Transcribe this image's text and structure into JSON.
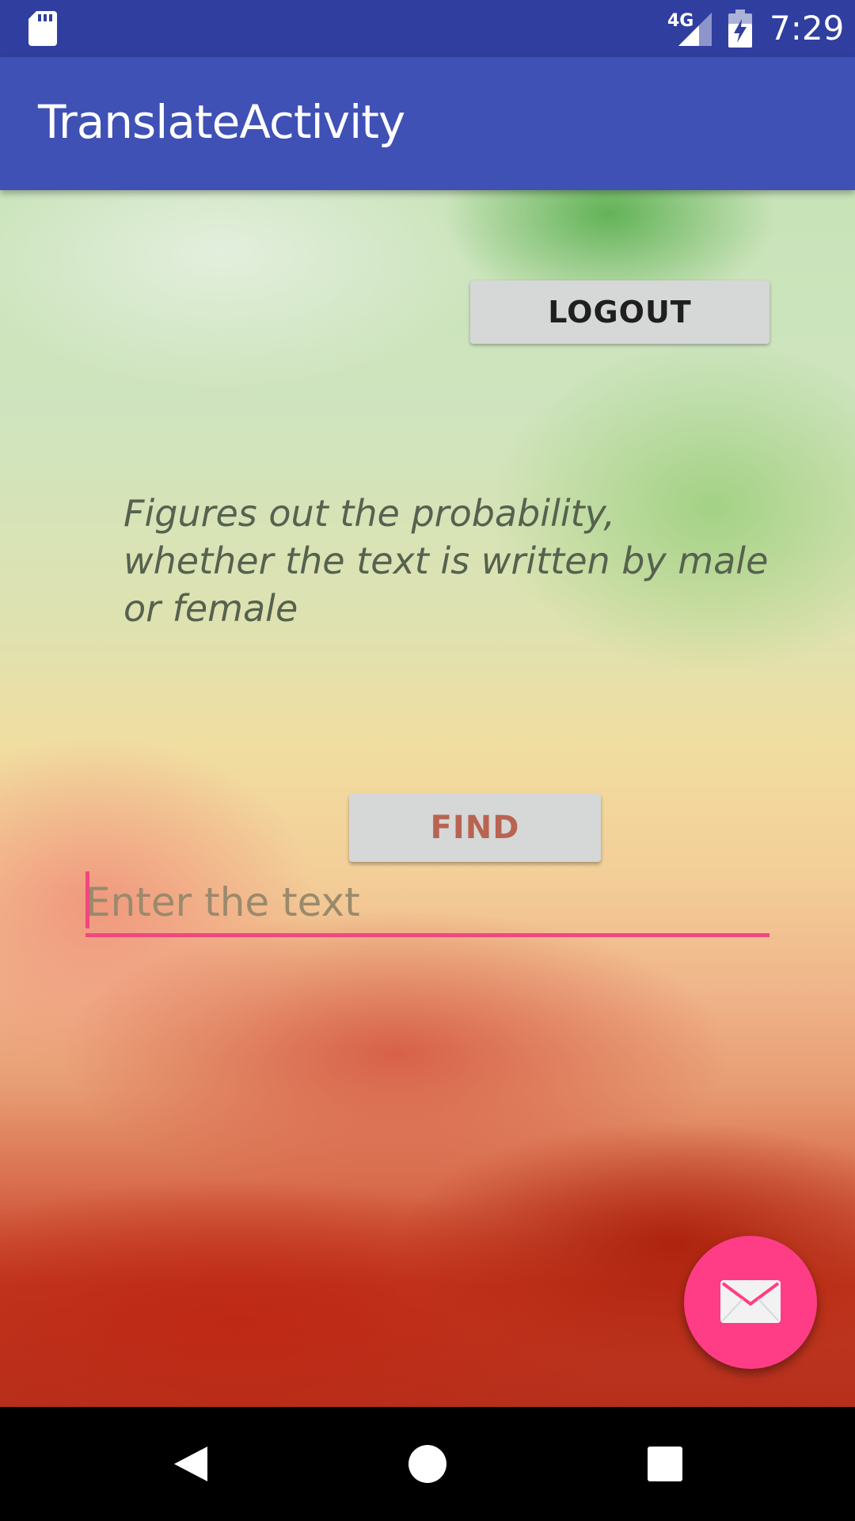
{
  "status_bar": {
    "network_label": "4G",
    "time": "7:29",
    "icons": [
      "sd-card-icon",
      "signal-icon",
      "battery-charging-icon"
    ]
  },
  "app_bar": {
    "title": "TranslateActivity"
  },
  "main": {
    "logout_label": "LOGOUT",
    "description": "Figures out the probability, whether the text is written by male or female",
    "text_input": {
      "value": "",
      "placeholder": "Enter the text"
    },
    "find_label": "FIND",
    "fab_icon": "mail-icon"
  },
  "nav_bar": {
    "icons": [
      "back-icon",
      "home-icon",
      "recents-icon"
    ]
  },
  "colors": {
    "status_bar": "#303F9F",
    "app_bar": "#3F51B5",
    "accent": "#F0487E",
    "fab": "#FF3D86",
    "button": "#D6D7D7",
    "find_text": "#B86450"
  }
}
